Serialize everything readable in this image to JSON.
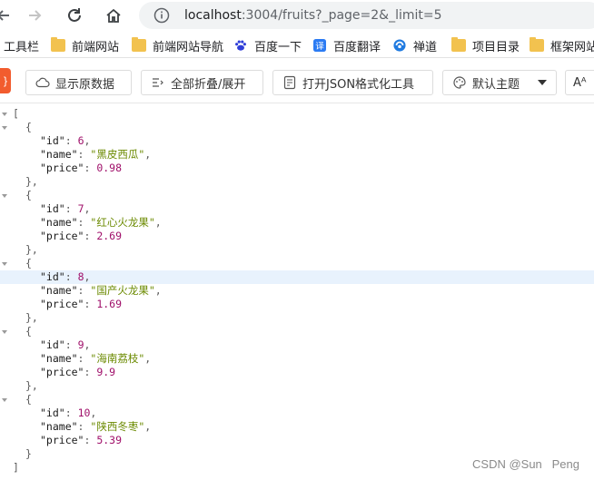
{
  "browser": {
    "url_host": "localhost",
    "url_rest": ":3004/fruits?_page=2&_limit=5"
  },
  "bookmarks": [
    {
      "label": "工具栏",
      "icon": "none"
    },
    {
      "label": "前端网站",
      "icon": "folder-icon"
    },
    {
      "label": "前端网站导航",
      "icon": "folder-icon"
    },
    {
      "label": "百度一下",
      "icon": "baidu-icon"
    },
    {
      "label": "百度翻译",
      "icon": "translate-icon"
    },
    {
      "label": "禅道",
      "icon": "zentao-icon"
    },
    {
      "label": "项目目录",
      "icon": "folder-icon"
    },
    {
      "label": "框架网站",
      "icon": "folder-icon"
    }
  ],
  "toolbar": {
    "logo": "}",
    "show_raw": "显示原数据",
    "collapse_expand": "全部折叠/展开",
    "open_tool": "打开JSON格式化工具",
    "theme": "默认主题",
    "font_btn": "Aᴬ"
  },
  "json": {
    "records": [
      {
        "id": "6",
        "name": "\"黑皮西瓜\"",
        "price": "0.98"
      },
      {
        "id": "7",
        "name": "\"红心火龙果\"",
        "price": "2.69"
      },
      {
        "id": "8",
        "name": "\"国产火龙果\"",
        "price": "1.69"
      },
      {
        "id": "9",
        "name": "\"海南荔枝\"",
        "price": "9.9"
      },
      {
        "id": "10",
        "name": "\"陕西冬枣\"",
        "price": "5.39"
      }
    ],
    "key_id": "\"id\"",
    "key_name": "\"name\"",
    "key_price": "\"price\""
  },
  "watermark": "CSDN @Sun   Peng"
}
